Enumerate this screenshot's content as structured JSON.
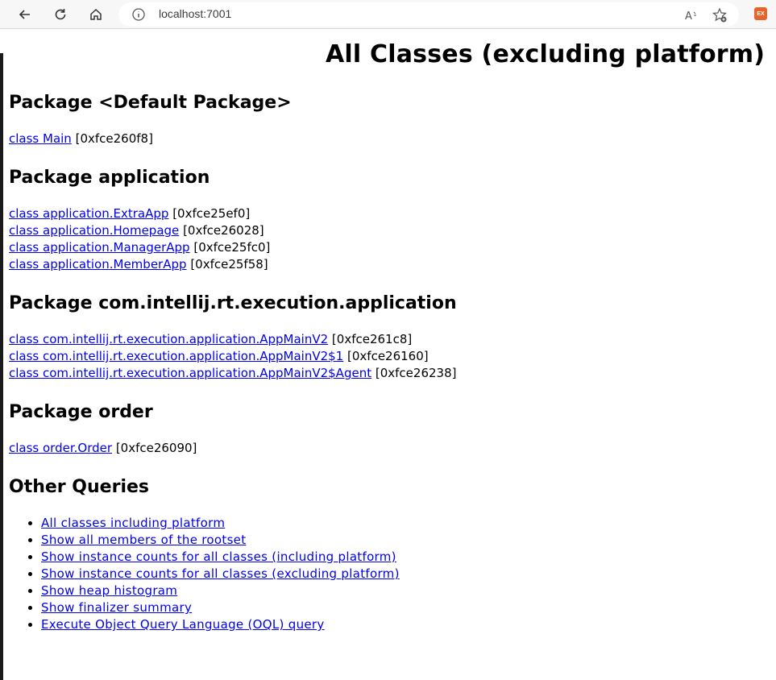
{
  "browser": {
    "url": "localhost:7001"
  },
  "page": {
    "title": "All Classes (excluding platform)",
    "packages": [
      {
        "heading": "Package <Default Package>",
        "classes": [
          {
            "name": "class Main",
            "addr": "[0xfce260f8]"
          }
        ]
      },
      {
        "heading": "Package application",
        "classes": [
          {
            "name": "class application.ExtraApp",
            "addr": "[0xfce25ef0]"
          },
          {
            "name": "class application.Homepage",
            "addr": "[0xfce26028]"
          },
          {
            "name": "class application.ManagerApp",
            "addr": "[0xfce25fc0]"
          },
          {
            "name": "class application.MemberApp",
            "addr": "[0xfce25f58]"
          }
        ]
      },
      {
        "heading": "Package com.intellij.rt.execution.application",
        "classes": [
          {
            "name": "class com.intellij.rt.execution.application.AppMainV2",
            "addr": "[0xfce261c8]"
          },
          {
            "name": "class com.intellij.rt.execution.application.AppMainV2$1",
            "addr": "[0xfce26160]"
          },
          {
            "name": "class com.intellij.rt.execution.application.AppMainV2$Agent",
            "addr": "[0xfce26238]"
          }
        ]
      },
      {
        "heading": "Package order",
        "classes": [
          {
            "name": "class order.Order",
            "addr": "[0xfce26090]"
          }
        ]
      }
    ],
    "other_queries": {
      "heading": "Other Queries",
      "links": [
        "All classes including platform",
        "Show all members of the rootset",
        "Show instance counts for all classes (including platform)",
        "Show instance counts for all classes (excluding platform)",
        "Show heap histogram",
        "Show finalizer summary",
        "Execute Object Query Language (OQL) query"
      ]
    }
  },
  "colors": {
    "link": "#0000ee",
    "extension": "#e8622c"
  }
}
